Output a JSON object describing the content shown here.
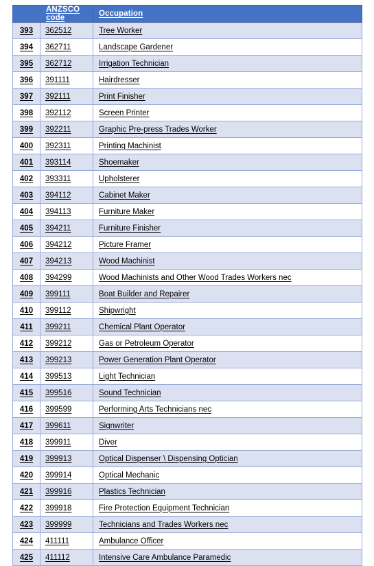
{
  "document": {
    "type": "spreadsheet-table",
    "title": "ANZSCO Occupation List"
  },
  "colors": {
    "header_background": "#4472C4",
    "header_text": "#FFFFFF",
    "row_band": "#DCE1F2",
    "row_alt": "#FFFFFF",
    "grid_line": "#95A9D6",
    "body_text": "#000000"
  },
  "table": {
    "headers": {
      "row_number": "",
      "code": "ANZSCO code",
      "occupation": "Occupation"
    },
    "rows": [
      {
        "n": "393",
        "code": "362512",
        "occupation": "Tree Worker"
      },
      {
        "n": "394",
        "code": "362711",
        "occupation": "Landscape Gardener"
      },
      {
        "n": "395",
        "code": "362712",
        "occupation": "Irrigation Technician"
      },
      {
        "n": "396",
        "code": "391111",
        "occupation": "Hairdresser"
      },
      {
        "n": "397",
        "code": "392111",
        "occupation": "Print Finisher"
      },
      {
        "n": "398",
        "code": "392112",
        "occupation": "Screen Printer"
      },
      {
        "n": "399",
        "code": "392211",
        "occupation": "Graphic Pre-press Trades Worker"
      },
      {
        "n": "400",
        "code": "392311",
        "occupation": "Printing Machinist"
      },
      {
        "n": "401",
        "code": "393114",
        "occupation": "Shoemaker"
      },
      {
        "n": "402",
        "code": "393311",
        "occupation": "Upholsterer"
      },
      {
        "n": "403",
        "code": "394112",
        "occupation": "Cabinet Maker"
      },
      {
        "n": "404",
        "code": "394113",
        "occupation": "Furniture Maker"
      },
      {
        "n": "405",
        "code": "394211",
        "occupation": "Furniture Finisher"
      },
      {
        "n": "406",
        "code": "394212",
        "occupation": "Picture Framer"
      },
      {
        "n": "407",
        "code": "394213",
        "occupation": "Wood Machinist"
      },
      {
        "n": "408",
        "code": "394299",
        "occupation": "Wood Machinists and Other Wood Trades Workers nec"
      },
      {
        "n": "409",
        "code": "399111",
        "occupation": "Boat Builder and Repairer"
      },
      {
        "n": "410",
        "code": "399112",
        "occupation": "Shipwright"
      },
      {
        "n": "411",
        "code": "399211",
        "occupation": "Chemical Plant Operator"
      },
      {
        "n": "412",
        "code": "399212",
        "occupation": "Gas or Petroleum Operator"
      },
      {
        "n": "413",
        "code": "399213",
        "occupation": "Power Generation Plant Operator"
      },
      {
        "n": "414",
        "code": "399513",
        "occupation": "Light Technician"
      },
      {
        "n": "415",
        "code": "399516",
        "occupation": "Sound Technician"
      },
      {
        "n": "416",
        "code": "399599",
        "occupation": "Performing Arts Technicians nec"
      },
      {
        "n": "417",
        "code": "399611",
        "occupation": "Signwriter"
      },
      {
        "n": "418",
        "code": "399911",
        "occupation": "Diver"
      },
      {
        "n": "419",
        "code": "399913",
        "occupation": "Optical Dispenser \\ Dispensing Optician"
      },
      {
        "n": "420",
        "code": "399914",
        "occupation": "Optical Mechanic"
      },
      {
        "n": "421",
        "code": "399916",
        "occupation": "Plastics Technician"
      },
      {
        "n": "422",
        "code": "399918",
        "occupation": "Fire Protection Equipment Technician"
      },
      {
        "n": "423",
        "code": "399999",
        "occupation": "Technicians and Trades Workers nec"
      },
      {
        "n": "424",
        "code": "411111",
        "occupation": "Ambulance Officer"
      },
      {
        "n": "425",
        "code": "411112",
        "occupation": "Intensive Care Ambulance Paramedic"
      }
    ]
  }
}
